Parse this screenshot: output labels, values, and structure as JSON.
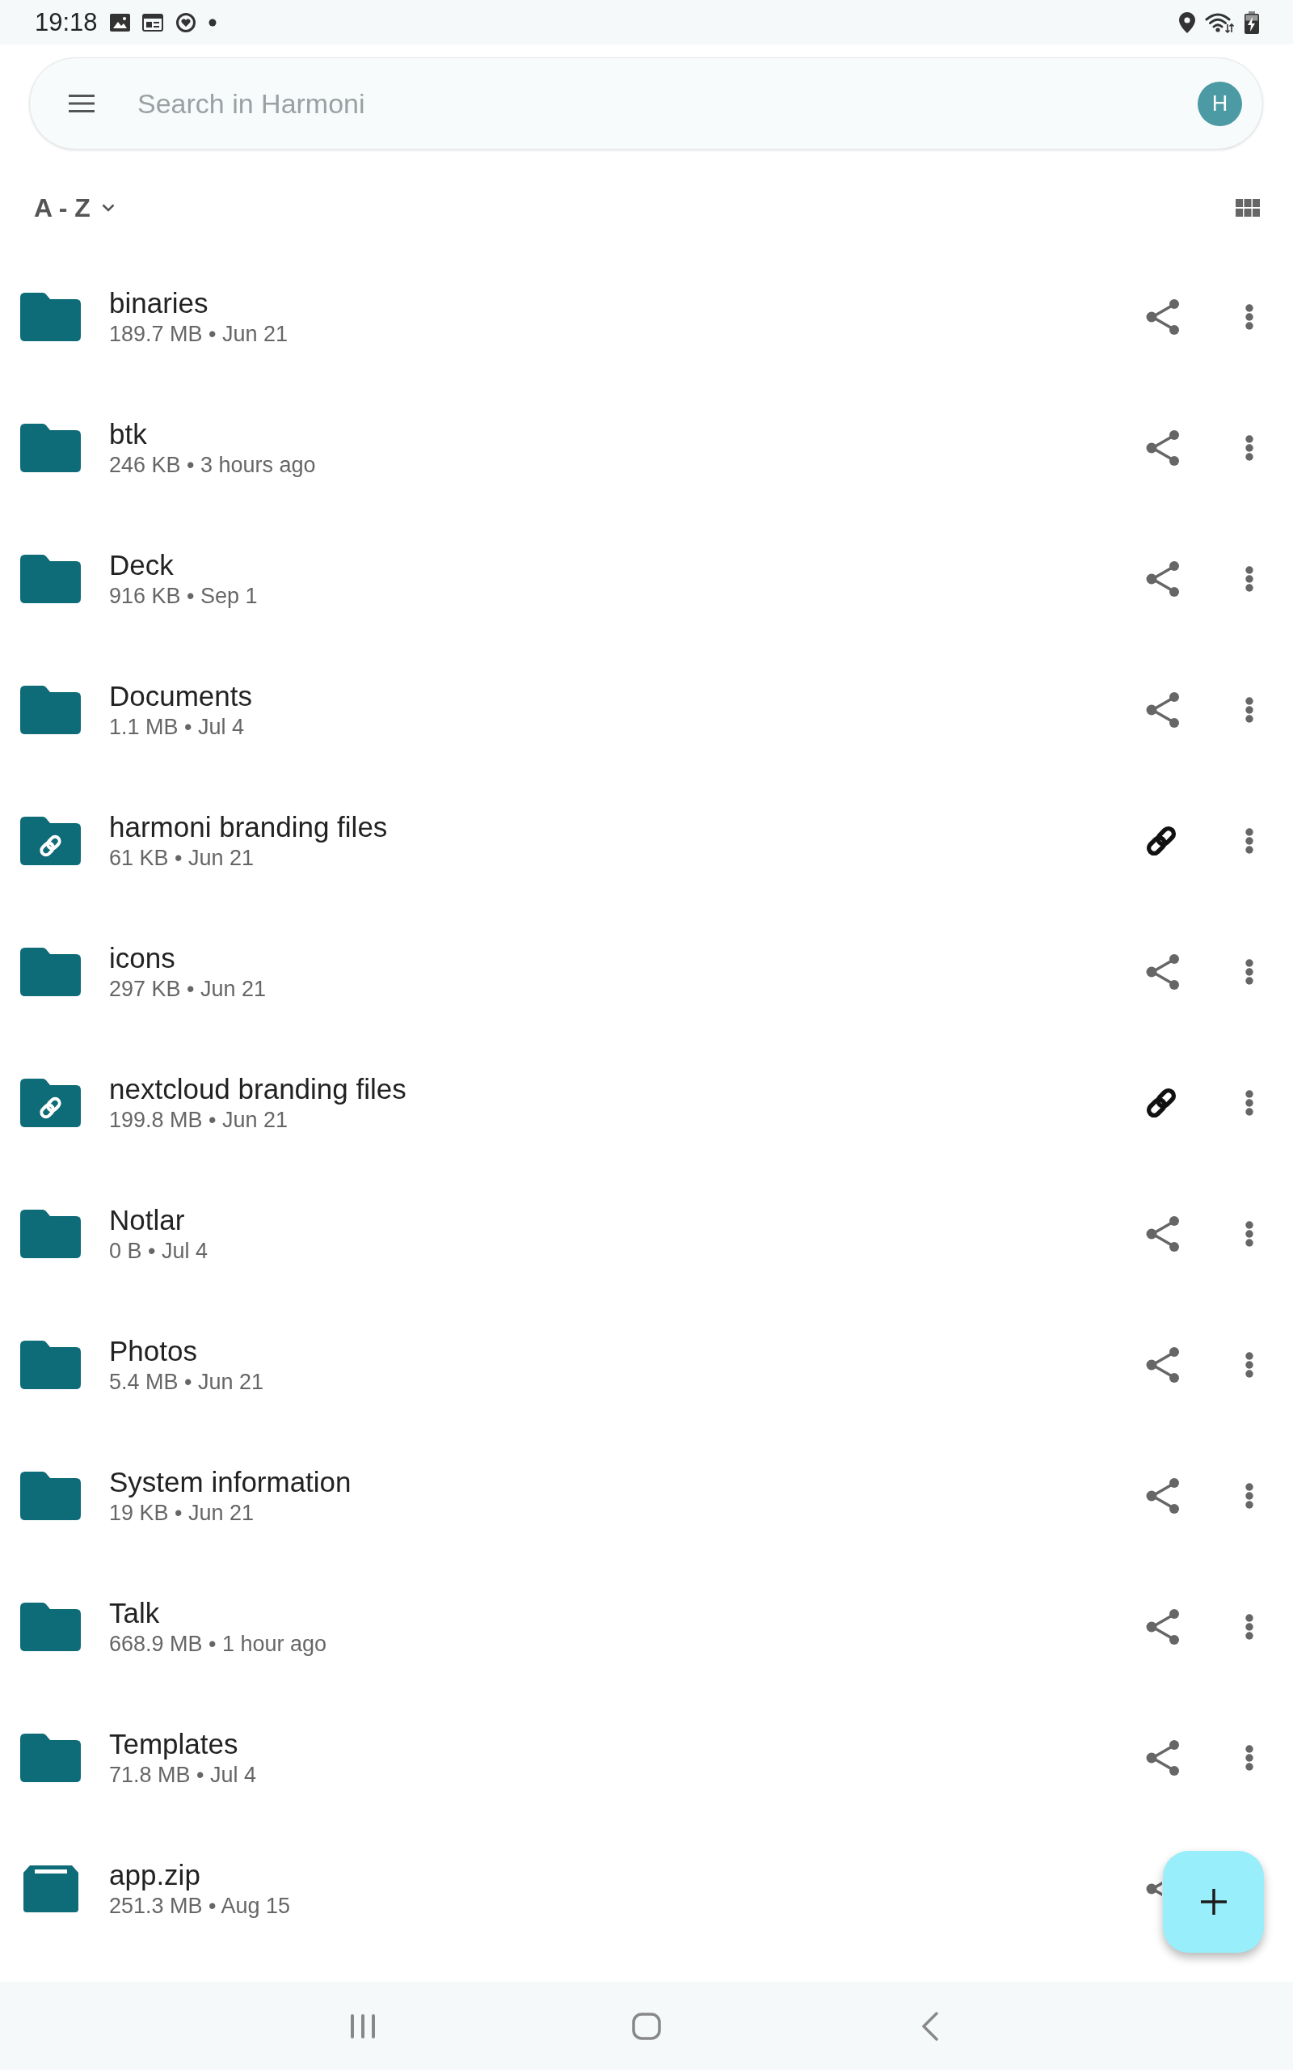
{
  "status_bar": {
    "time": "19:18"
  },
  "search": {
    "placeholder": "Search in Harmoni",
    "avatar_initial": "H"
  },
  "sort": {
    "label": "A - Z"
  },
  "files": [
    {
      "name": "binaries",
      "details": "189.7 MB • Jun 21",
      "kind": "folder",
      "shared_link": false
    },
    {
      "name": "btk",
      "details": "246 KB • 3 hours ago",
      "kind": "folder",
      "shared_link": false
    },
    {
      "name": "Deck",
      "details": "916 KB • Sep 1",
      "kind": "folder",
      "shared_link": false
    },
    {
      "name": "Documents",
      "details": "1.1 MB • Jul 4",
      "kind": "folder",
      "shared_link": false
    },
    {
      "name": "harmoni branding files",
      "details": "61 KB • Jun 21",
      "kind": "folder",
      "shared_link": true
    },
    {
      "name": "icons",
      "details": "297 KB • Jun 21",
      "kind": "folder",
      "shared_link": false
    },
    {
      "name": "nextcloud branding files",
      "details": "199.8 MB • Jun 21",
      "kind": "folder",
      "shared_link": true
    },
    {
      "name": "Notlar",
      "details": "0 B • Jul 4",
      "kind": "folder",
      "shared_link": false
    },
    {
      "name": "Photos",
      "details": "5.4 MB • Jun 21",
      "kind": "folder",
      "shared_link": false
    },
    {
      "name": "System information",
      "details": "19 KB • Jun 21",
      "kind": "folder",
      "shared_link": false
    },
    {
      "name": "Talk",
      "details": "668.9 MB • 1 hour ago",
      "kind": "folder",
      "shared_link": false
    },
    {
      "name": "Templates",
      "details": "71.8 MB • Jul 4",
      "kind": "folder",
      "shared_link": false
    },
    {
      "name": "app.zip",
      "details": "251.3 MB • Aug 15",
      "kind": "archive",
      "shared_link": false
    }
  ]
}
